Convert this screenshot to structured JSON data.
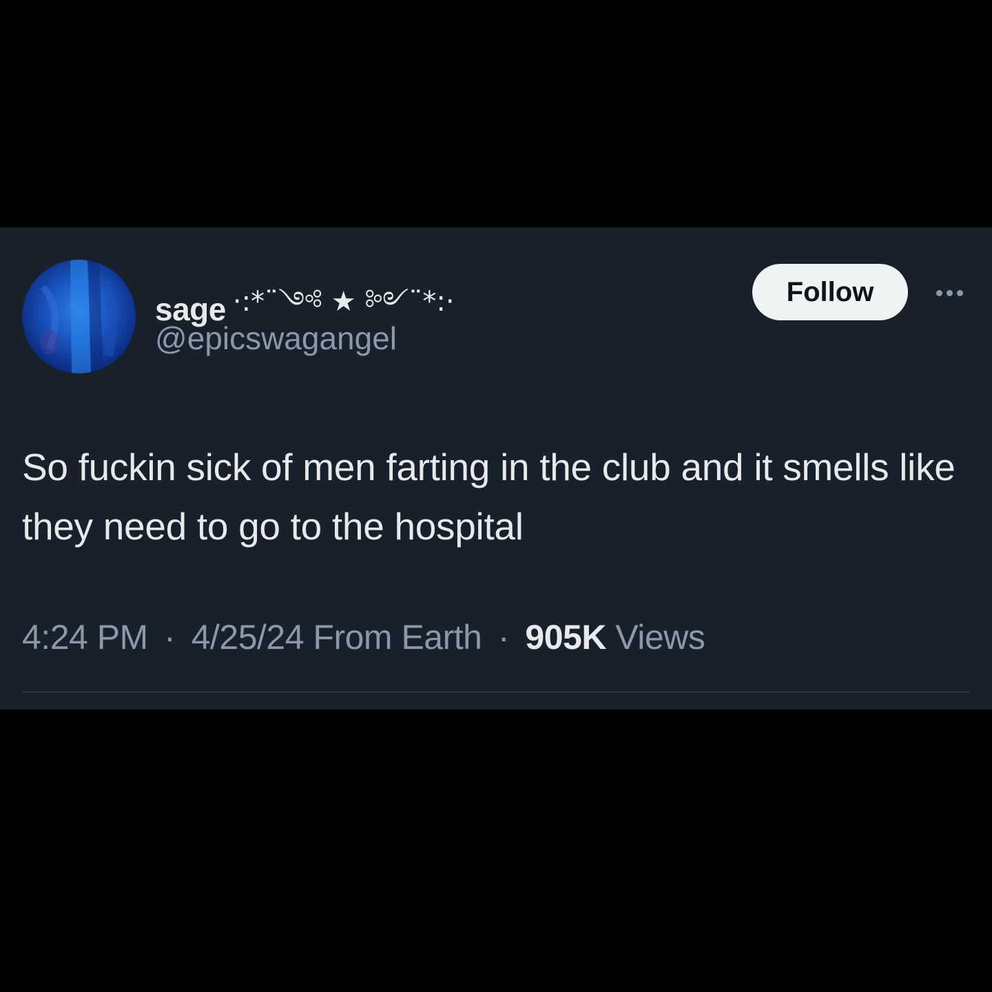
{
  "tweet": {
    "author": {
      "display_name": "sage",
      "name_decoration": "·:*¨༺ ★ ༻¨*:·",
      "handle": "@epicswagangel"
    },
    "follow_label": "Follow",
    "text": "So fuckin sick of men farting in the club and it smells like they need to go to the hospital",
    "meta": {
      "time": "4:24 PM",
      "separator": "·",
      "date_source": "4/25/24 From Earth",
      "views_count": "905K",
      "views_label": "Views"
    }
  },
  "colors": {
    "page_background": "#000000",
    "card_background": "#17202b",
    "primary_text": "#e7e9ea",
    "secondary_text": "#8b98a5",
    "follow_button_bg": "#eff3f4",
    "follow_button_text": "#0f1419",
    "divider": "#38444d",
    "avatar_tint": "#1a58c4"
  },
  "icons": {
    "more": "more-horizontal-icon"
  }
}
